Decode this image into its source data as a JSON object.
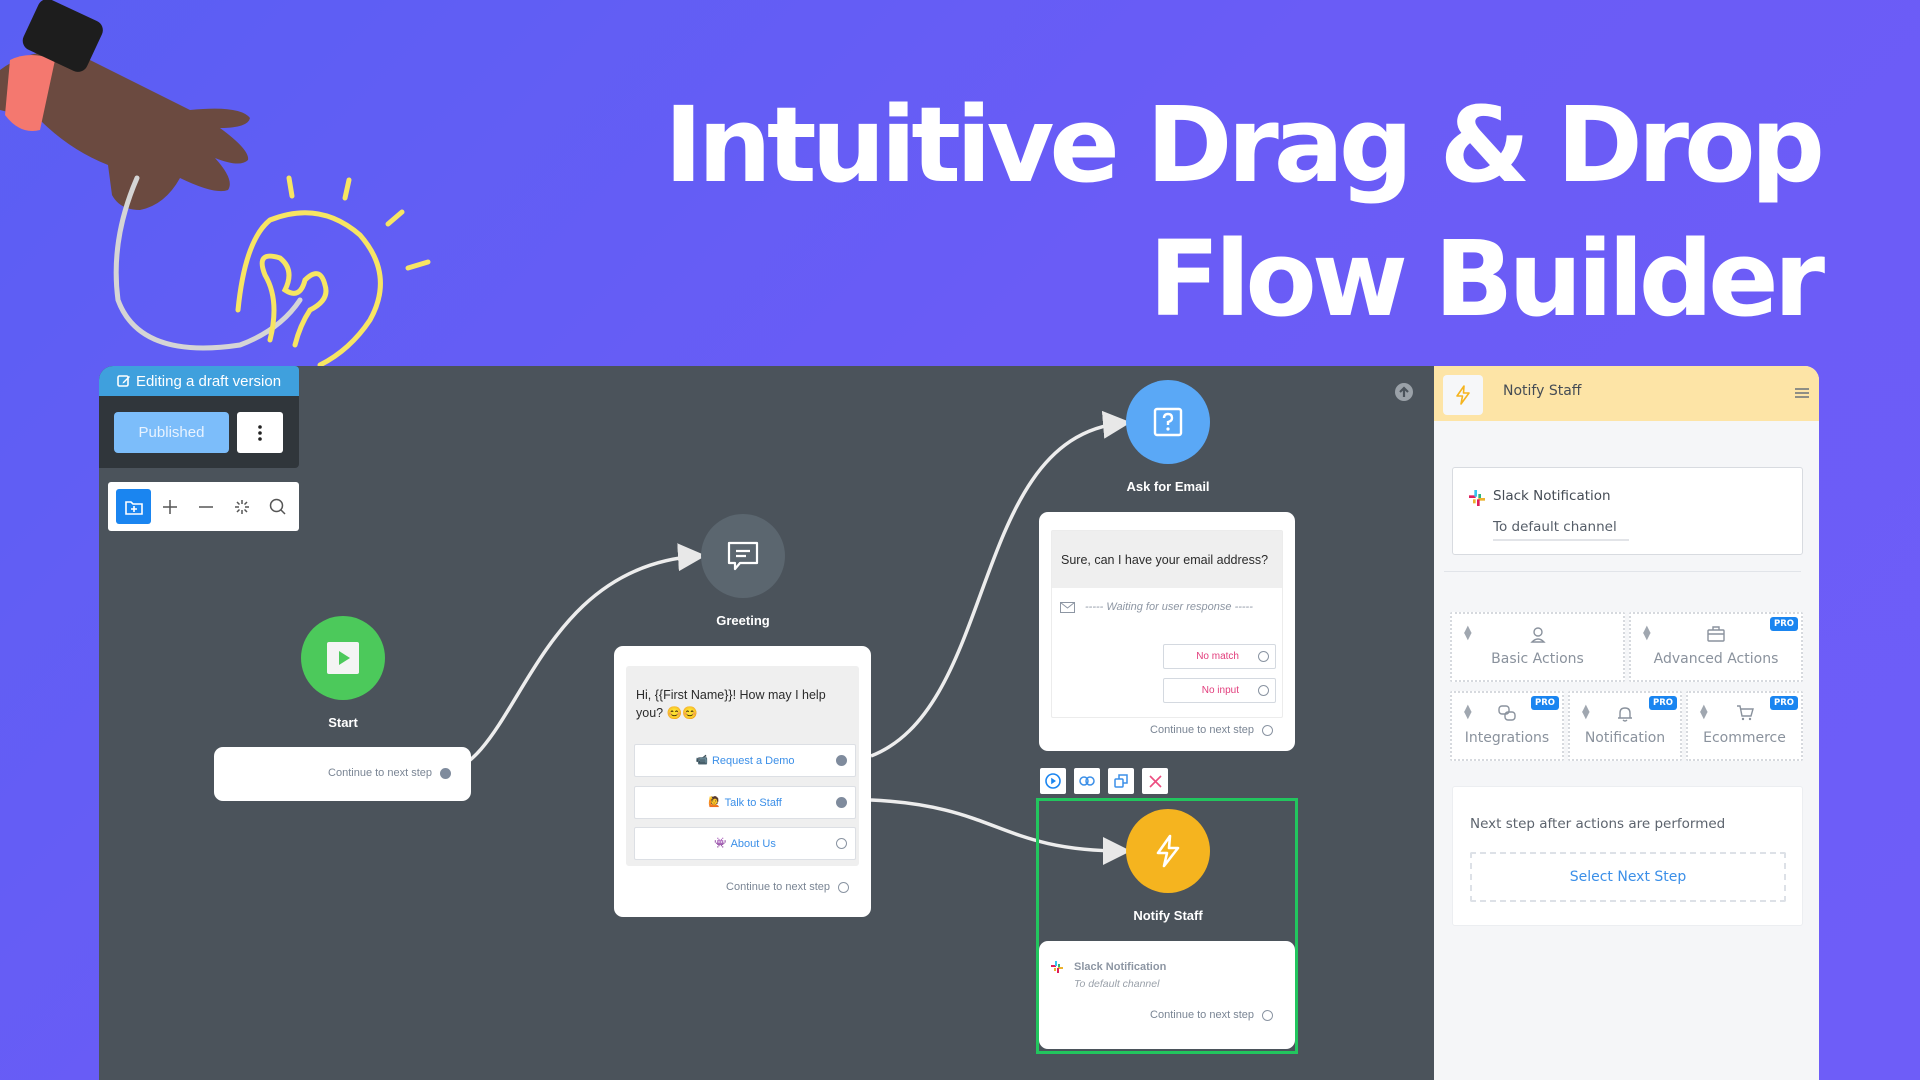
{
  "hero": {
    "title_line1": "Intuitive Drag & Drop",
    "title_line2": "Flow Builder"
  },
  "editor": {
    "draft_badge": "Editing a draft version",
    "publish_button": "Published",
    "toolbar": {
      "tools": [
        "folder-add-icon",
        "zoom-in-icon",
        "zoom-out-icon",
        "auto-arrange-icon",
        "search-icon"
      ]
    }
  },
  "nodes": {
    "start": {
      "label": "Start",
      "continue": "Continue to next step",
      "color": "#4cc95b"
    },
    "greeting": {
      "label": "Greeting",
      "message": "Hi, {{First Name}}! How may I help you? 😊😊",
      "choices": [
        {
          "icon": "📹",
          "label": "Request a Demo",
          "connected": true
        },
        {
          "icon": "🙋",
          "label": "Talk to Staff",
          "connected": true
        },
        {
          "icon": "👾",
          "label": "About Us",
          "connected": false
        }
      ],
      "continue": "Continue to next step",
      "color": "#5b666f"
    },
    "ask_email": {
      "label": "Ask for Email",
      "message": "Sure, can I have your email address?",
      "waiting": "----- Waiting for user response -----",
      "no_match": "No match",
      "no_input": "No input",
      "continue": "Continue to next step",
      "color": "#5aa8f6"
    },
    "notify_staff": {
      "label": "Notify Staff",
      "action_title": "Slack Notification",
      "action_sub": "To default channel",
      "continue": "Continue to next step",
      "color": "#f5b41f",
      "selected": true
    }
  },
  "node_tools": [
    "play-icon",
    "link-icon",
    "duplicate-icon",
    "delete-icon"
  ],
  "panel": {
    "title": "Notify Staff",
    "slack": {
      "title": "Slack Notification",
      "subtitle": "To default channel"
    },
    "actions": [
      {
        "label": "Basic Actions",
        "icon": "user-pin-icon",
        "pro": false
      },
      {
        "label": "Advanced Actions",
        "icon": "briefcase-icon",
        "pro": true
      },
      {
        "label": "Integrations",
        "icon": "integrations-icon",
        "pro": true
      },
      {
        "label": "Notification",
        "icon": "bell-icon",
        "pro": true
      },
      {
        "label": "Ecommerce",
        "icon": "cart-icon",
        "pro": true
      }
    ],
    "pro_badge": "PRO",
    "next_step_label": "Next step after actions are performed",
    "select_next_step": "Select Next Step"
  }
}
